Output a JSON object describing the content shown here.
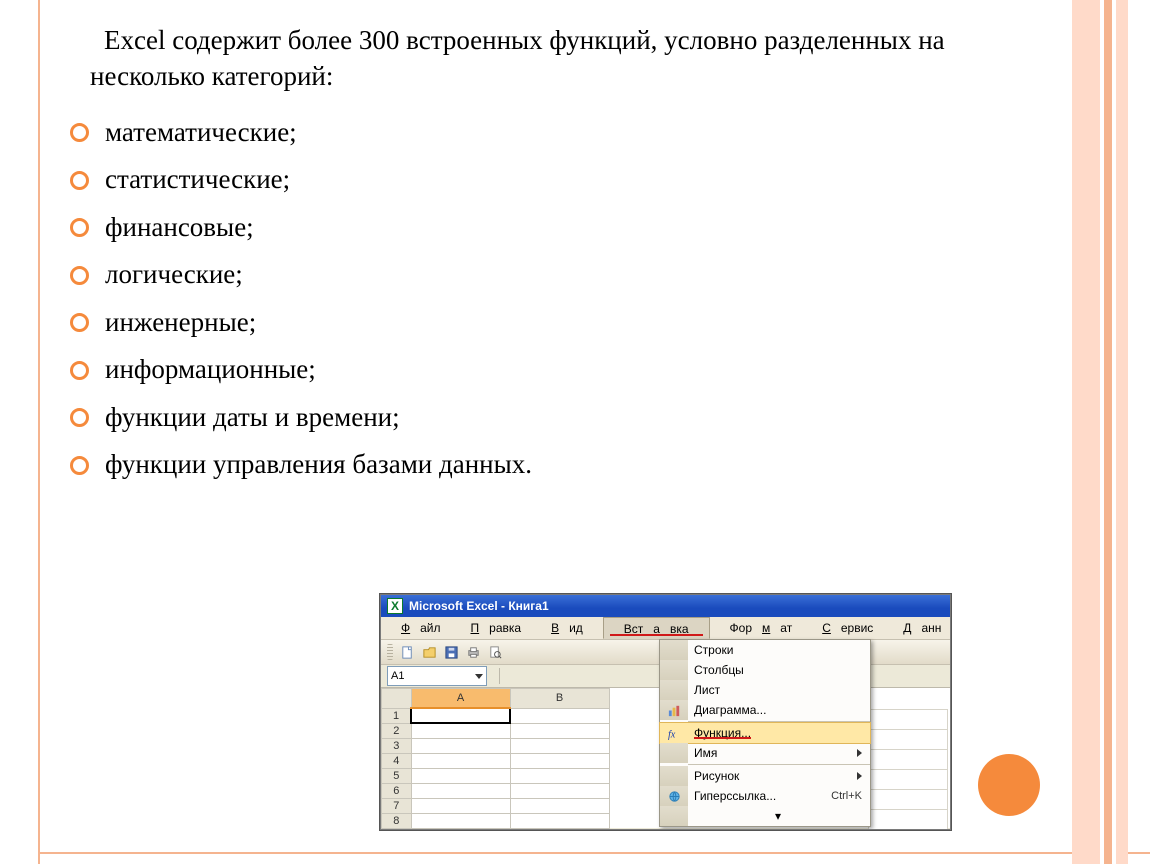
{
  "intro": "Excel содержит более 300 встроенных функций, условно разделенных на несколько категорий:",
  "bullets": [
    "математические;",
    "статистические;",
    "финансовые;",
    "логические;",
    "инженерные;",
    "информационные;",
    "функции даты и времени;",
    "функции управления базами данных."
  ],
  "excel": {
    "title": "Microsoft Excel - Книга1",
    "menus": [
      {
        "u": "Ф",
        "rest": "айл"
      },
      {
        "u": "П",
        "rest": "равка"
      },
      {
        "u": "В",
        "rest": "ид"
      },
      {
        "pre": "Вст",
        "u": "а",
        "rest": "вка"
      },
      {
        "pre": "Фор",
        "u": "м",
        "rest": "ат"
      },
      {
        "u": "С",
        "rest": "ервис"
      },
      {
        "u": "Д",
        "rest": "анн"
      }
    ],
    "active_cell": "A1",
    "cols": [
      "A",
      "B"
    ],
    "rows": [
      "1",
      "2",
      "3",
      "4",
      "5",
      "6",
      "7",
      "8"
    ],
    "dropdown": [
      {
        "label": "Строки"
      },
      {
        "label": "Столбцы"
      },
      {
        "label": "Лист"
      },
      {
        "label": "Диаграмма..."
      },
      {
        "label": "Функция..."
      },
      {
        "label": "Имя"
      },
      {
        "label": "Рисунок"
      },
      {
        "label": "Гиперссылка...",
        "shortcut": "Ctrl+K"
      }
    ]
  }
}
